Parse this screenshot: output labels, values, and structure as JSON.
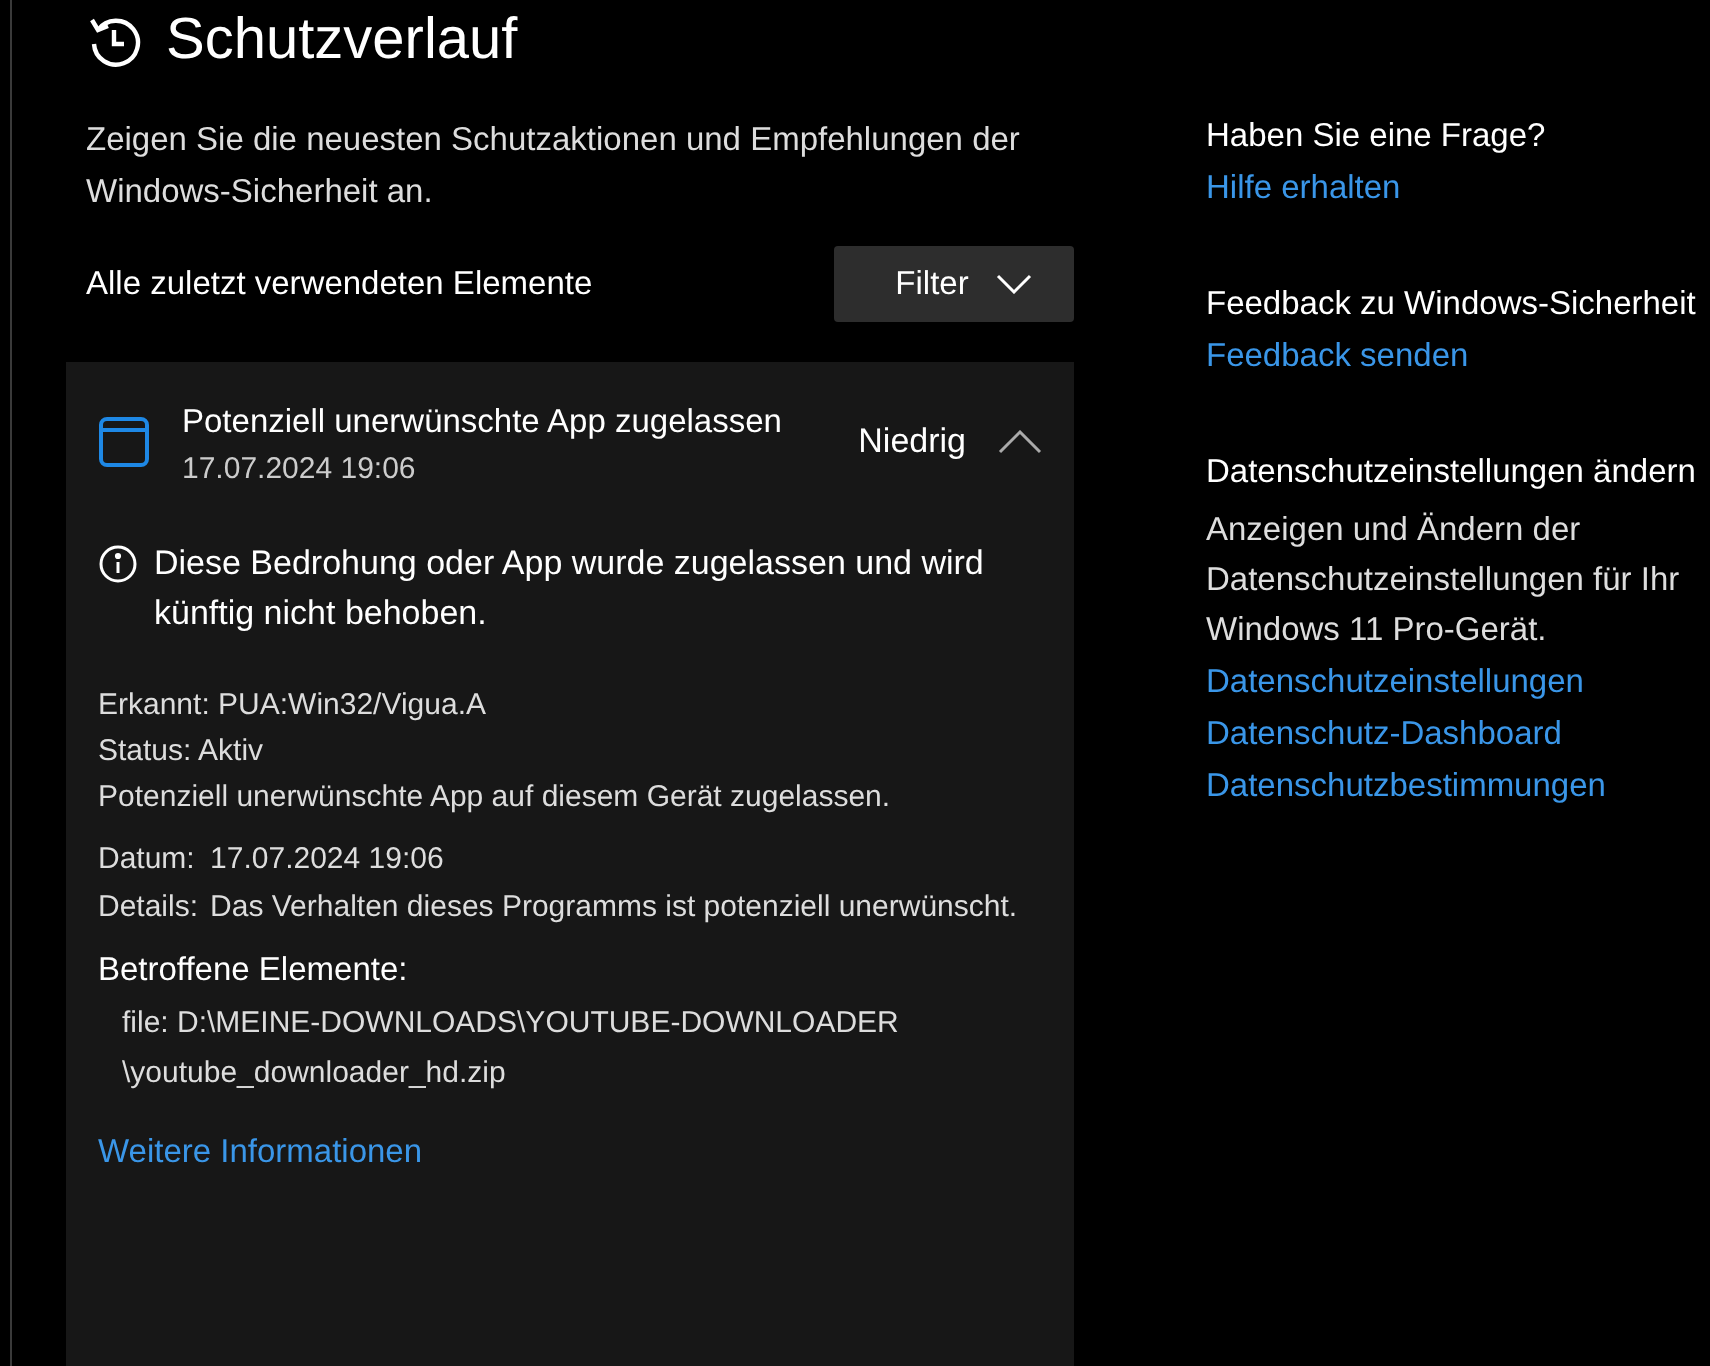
{
  "page": {
    "title": "Schutzverlauf",
    "description": "Zeigen Sie die neuesten Schutzaktionen und Empfehlungen der Windows-Sicherheit an."
  },
  "list_header": {
    "label": "Alle zuletzt verwendeten Elemente",
    "filter_button": "Filter"
  },
  "items": [
    {
      "title": "Potenziell unerwünschte App zugelassen",
      "date": "17.07.2024 19:06",
      "severity": "Niedrig",
      "expanded": true,
      "notice": "Diese Bedrohung oder App wurde zugelassen und wird künftig nicht behoben.",
      "info_lines": [
        "Erkannt: PUA:Win32/Vigua.A",
        "Status: Aktiv",
        "Potenziell unerwünschte App auf diesem Gerät zugelassen."
      ],
      "fields": [
        {
          "label": "Datum:",
          "value": "17.07.2024 19:06"
        },
        {
          "label": "Details:",
          "value": "Das Verhalten dieses Programms ist potenziell unerwünscht."
        }
      ],
      "affected_heading": "Betroffene Elemente:",
      "affected_path_lines": [
        "file: D:\\MEINE-DOWNLOADS\\YOUTUBE-DOWNLOADER",
        "\\youtube_downloader_hd.zip"
      ],
      "more_link": "Weitere Informationen"
    }
  ],
  "sidebar": [
    {
      "heading": "Haben Sie eine Frage?",
      "links": [
        "Hilfe erhalten"
      ]
    },
    {
      "heading": "Feedback zu Windows-Sicherheit",
      "links": [
        "Feedback senden"
      ]
    },
    {
      "heading": "Datenschutzeinstellungen ändern",
      "text": "Anzeigen und Ändern der Datenschutzeinstellungen für Ihr Windows 11 Pro-Gerät.",
      "links": [
        "Datenschutzeinstellungen",
        "Datenschutz-Dashboard",
        "Datenschutzbestimmungen"
      ]
    }
  ]
}
